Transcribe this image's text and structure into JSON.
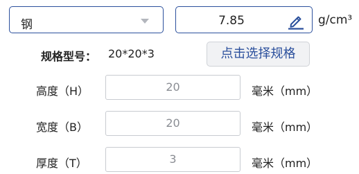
{
  "material": {
    "selected": "钢",
    "caret_icon": "dropdown-caret-icon"
  },
  "density": {
    "value": "7.85",
    "unit": "g/cm³",
    "edit_icon": "pencil-icon",
    "accent_color": "#2a4f9c"
  },
  "spec": {
    "label": "规格型号：",
    "value": "20*20*3",
    "button_label": "点击选择规格"
  },
  "dimensions": [
    {
      "label": "高度（H）",
      "value": "20",
      "unit": "毫米（mm）"
    },
    {
      "label": "宽度（B）",
      "value": "20",
      "unit": "毫米（mm）"
    },
    {
      "label": "厚度（T）",
      "value": "3",
      "unit": "毫米（mm）"
    }
  ]
}
